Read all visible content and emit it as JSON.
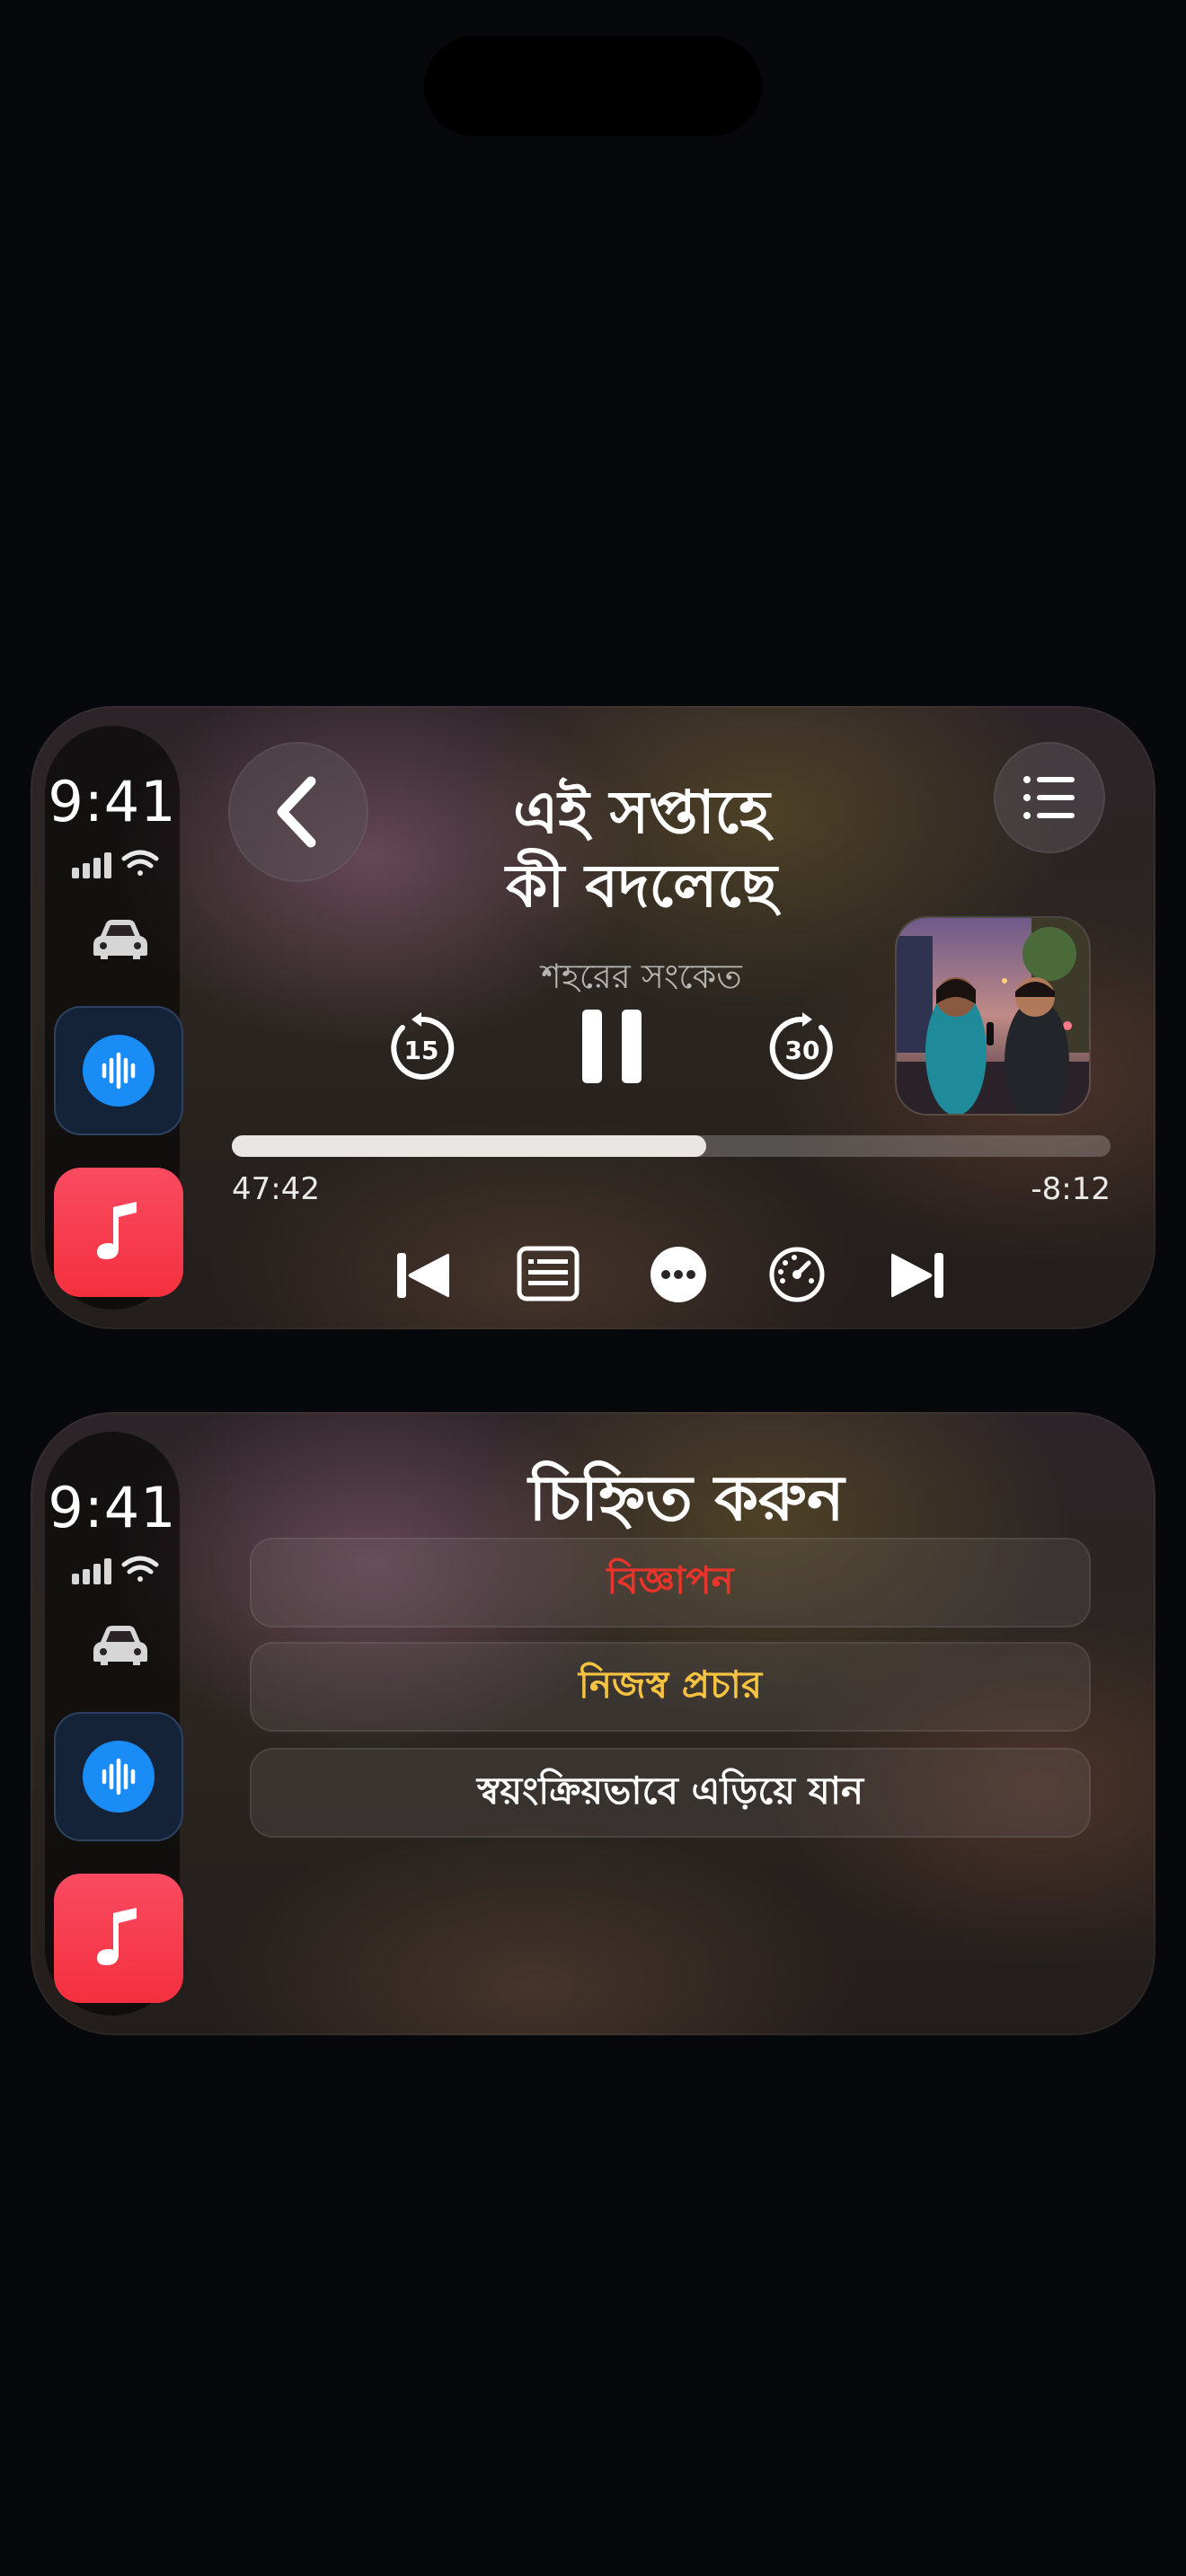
{
  "status": {
    "time": "9:41"
  },
  "player": {
    "title_line1": "এই সপ্তাহে",
    "title_line2": "কী বদলেছে",
    "show": "শহরের সংকেত",
    "elapsed": "47:42",
    "remaining": "-8:12",
    "progress": 0.54,
    "skip_back_seconds": "15",
    "skip_forward_seconds": "30"
  },
  "mark_sheet": {
    "title": "চিহ্নিত করুন",
    "options": [
      {
        "label": "বিজ্ঞাপন",
        "color": "#e8342a"
      },
      {
        "label": "নিজস্ব প্রচার",
        "color": "#f5c242"
      },
      {
        "label": "স্বয়ংক্রিয়ভাবে এড়িয়ে যান",
        "color": "#ffffff"
      }
    ]
  },
  "icons": {
    "sidebar": [
      "signal-icon",
      "wifi-icon",
      "car-icon",
      "podcasts-app-icon",
      "music-app-icon"
    ],
    "player": [
      "back-icon",
      "queue-icon",
      "skip-back-15-icon",
      "pause-icon",
      "skip-forward-30-icon",
      "previous-icon",
      "transcript-icon",
      "more-icon",
      "playback-speed-icon",
      "next-icon"
    ]
  }
}
